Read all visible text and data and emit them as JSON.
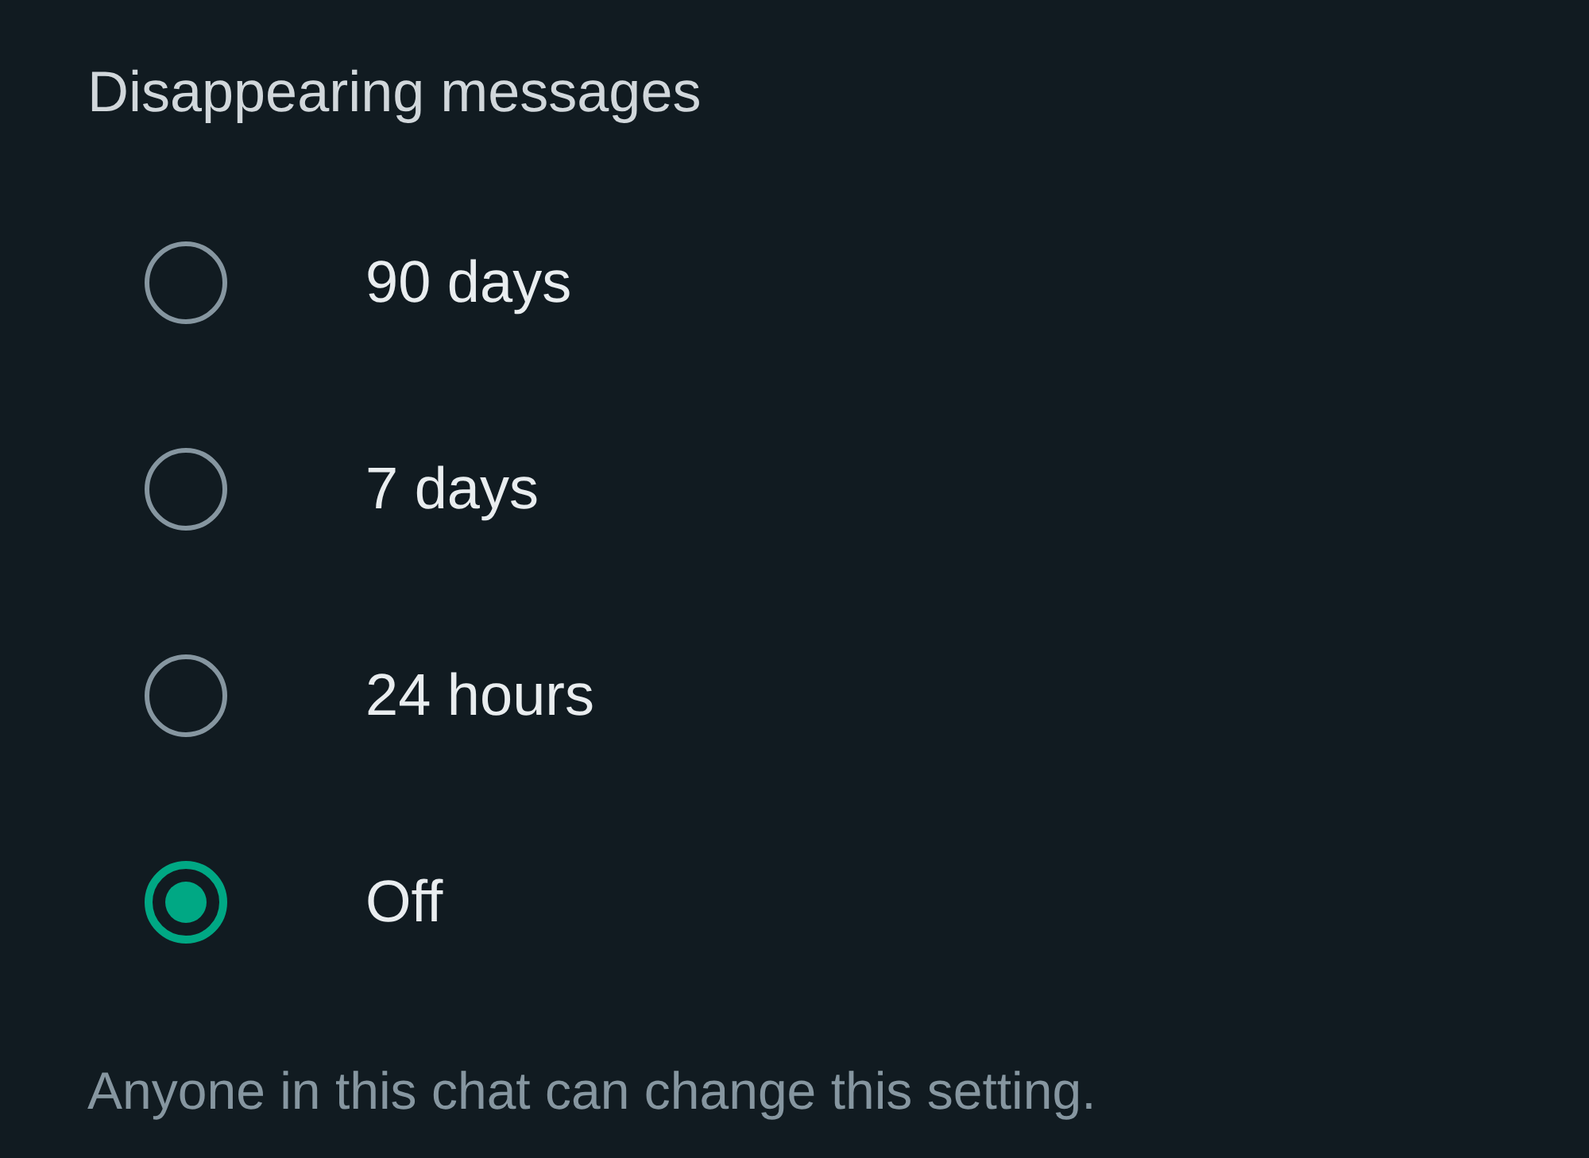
{
  "title": "Disappearing messages",
  "options": [
    {
      "label": "90 days",
      "selected": false
    },
    {
      "label": "7 days",
      "selected": false
    },
    {
      "label": "24 hours",
      "selected": false
    },
    {
      "label": "Off",
      "selected": true
    }
  ],
  "footer": "Anyone in this chat can change this setting."
}
